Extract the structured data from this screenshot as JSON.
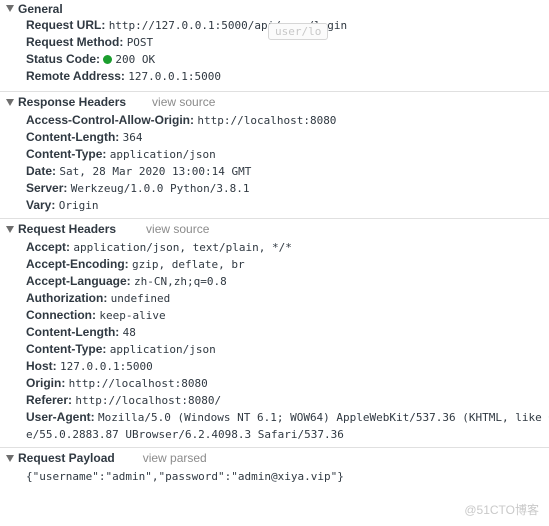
{
  "general": {
    "title": "General",
    "rows": [
      {
        "key": "Request URL:",
        "value": "http://127.0.0.1:5000/api/user/login"
      },
      {
        "key": "Request Method:",
        "value": "POST"
      },
      {
        "key": "Status Code:",
        "value": "200 OK",
        "status_color": "#1b9e2e"
      },
      {
        "key": "Remote Address:",
        "value": "127.0.0.1:5000"
      }
    ],
    "tooltip": "user/lo"
  },
  "response_headers": {
    "title": "Response Headers",
    "link": "view source",
    "rows": [
      {
        "key": "Access-Control-Allow-Origin:",
        "value": "http://localhost:8080"
      },
      {
        "key": "Content-Length:",
        "value": "364"
      },
      {
        "key": "Content-Type:",
        "value": "application/json"
      },
      {
        "key": "Date:",
        "value": "Sat, 28 Mar 2020 13:00:14 GMT"
      },
      {
        "key": "Server:",
        "value": "Werkzeug/1.0.0 Python/3.8.1"
      },
      {
        "key": "Vary:",
        "value": "Origin"
      }
    ]
  },
  "request_headers": {
    "title": "Request Headers",
    "link": "view source",
    "rows": [
      {
        "key": "Accept:",
        "value": "application/json, text/plain, */*"
      },
      {
        "key": "Accept-Encoding:",
        "value": "gzip, deflate, br"
      },
      {
        "key": "Accept-Language:",
        "value": "zh-CN,zh;q=0.8"
      },
      {
        "key": "Authorization:",
        "value": "undefined"
      },
      {
        "key": "Connection:",
        "value": "keep-alive"
      },
      {
        "key": "Content-Length:",
        "value": "48"
      },
      {
        "key": "Content-Type:",
        "value": "application/json"
      },
      {
        "key": "Host:",
        "value": "127.0.0.1:5000"
      },
      {
        "key": "Origin:",
        "value": "http://localhost:8080"
      },
      {
        "key": "Referer:",
        "value": "http://localhost:8080/"
      }
    ],
    "user_agent": {
      "key": "User-Agent:",
      "value_line1": "Mozilla/5.0 (Windows NT 6.1; WOW64) AppleWebKit/537.36 (KHTML, like G",
      "value_line2": "e/55.0.2883.87 UBrowser/6.2.4098.3 Safari/537.36"
    }
  },
  "request_payload": {
    "title": "Request Payload",
    "link": "view parsed",
    "body": "{\"username\":\"admin\",\"password\":\"admin@xiya.vip\"}"
  },
  "watermark": "@51CTO博客"
}
